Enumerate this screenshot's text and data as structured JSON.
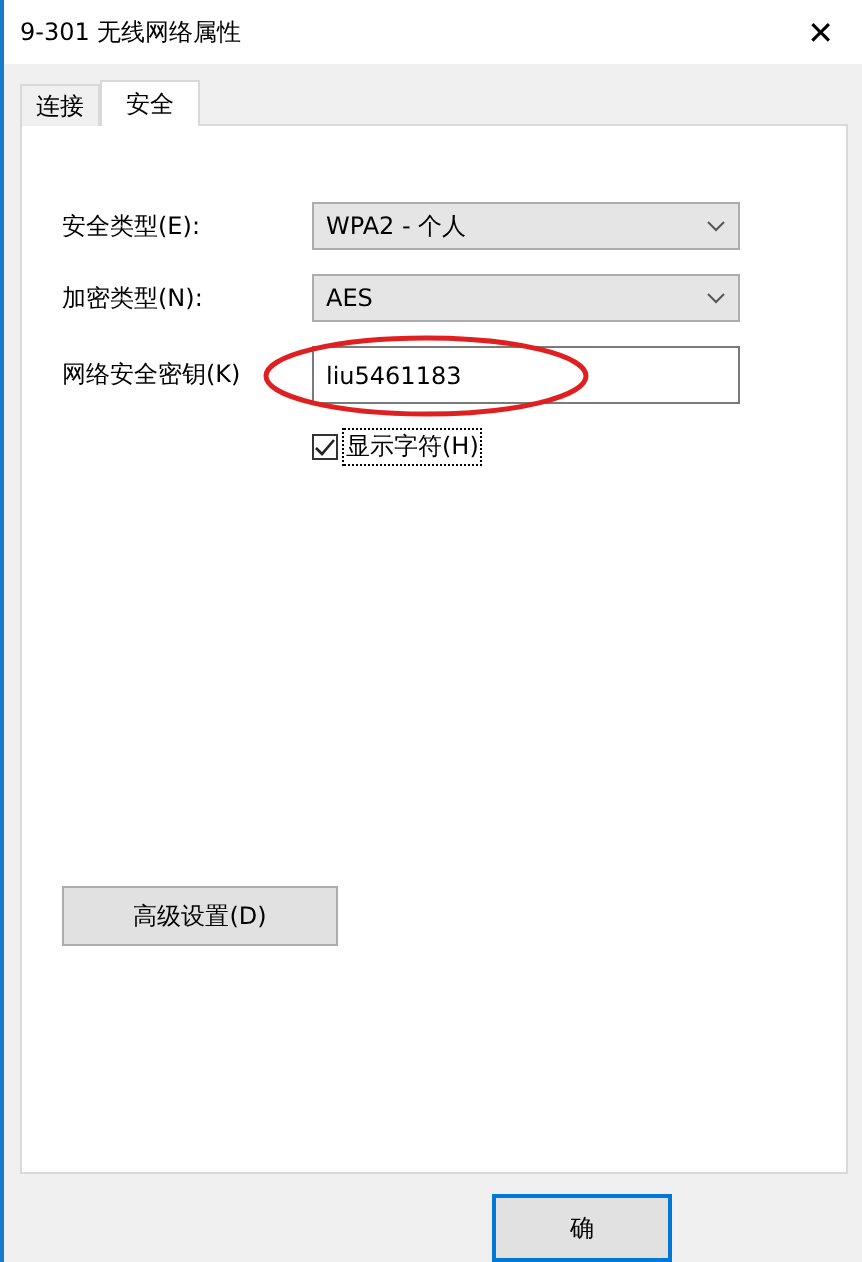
{
  "window": {
    "title": "9-301 无线网络属性",
    "close": "✕"
  },
  "tabs": [
    {
      "label": "连接",
      "selected": false
    },
    {
      "label": "安全",
      "selected": true
    }
  ],
  "fields": [
    {
      "kind": "select",
      "label": "安全类型(E):",
      "value": "WPA2 - 个人"
    },
    {
      "kind": "select",
      "label": "加密类型(N):",
      "value": "AES"
    },
    {
      "kind": "input",
      "label": "网络安全密钥(K)",
      "value": "liu5461183",
      "highlighted": true
    }
  ],
  "show_characters": {
    "label": "显示字符(H)",
    "checked": true
  },
  "advanced_button": "高级设置(D)",
  "footer_buttons": [
    {
      "label": "确",
      "default": true
    }
  ]
}
